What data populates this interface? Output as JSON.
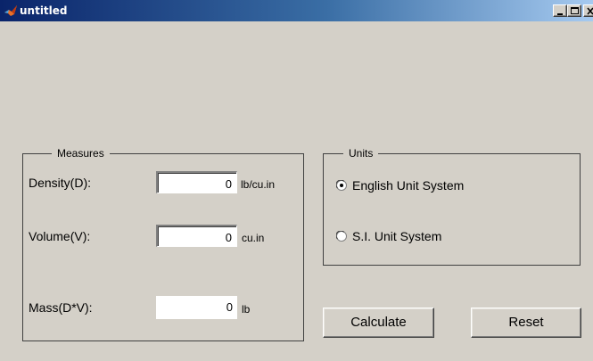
{
  "window": {
    "title": "untitled",
    "controls": [
      "minimize",
      "maximize",
      "close"
    ],
    "icon": "matlab-icon"
  },
  "measures": {
    "title": "Measures",
    "density": {
      "label": "Density(D):",
      "value": "0",
      "unit": "lb/cu.in"
    },
    "volume": {
      "label": "Volume(V):",
      "value": "0",
      "unit": "cu.in"
    },
    "mass": {
      "label": "Mass(D*V):",
      "value": "0",
      "unit": "lb"
    }
  },
  "units": {
    "title": "Units",
    "options": [
      {
        "label": "English Unit System",
        "selected": true
      },
      {
        "label": "S.I. Unit System",
        "selected": false
      }
    ]
  },
  "buttons": {
    "calculate": "Calculate",
    "reset": "Reset"
  },
  "colors": {
    "window_bg": "#d4d0c8",
    "titlebar_start": "#0a246a",
    "titlebar_end": "#a6caf0"
  }
}
